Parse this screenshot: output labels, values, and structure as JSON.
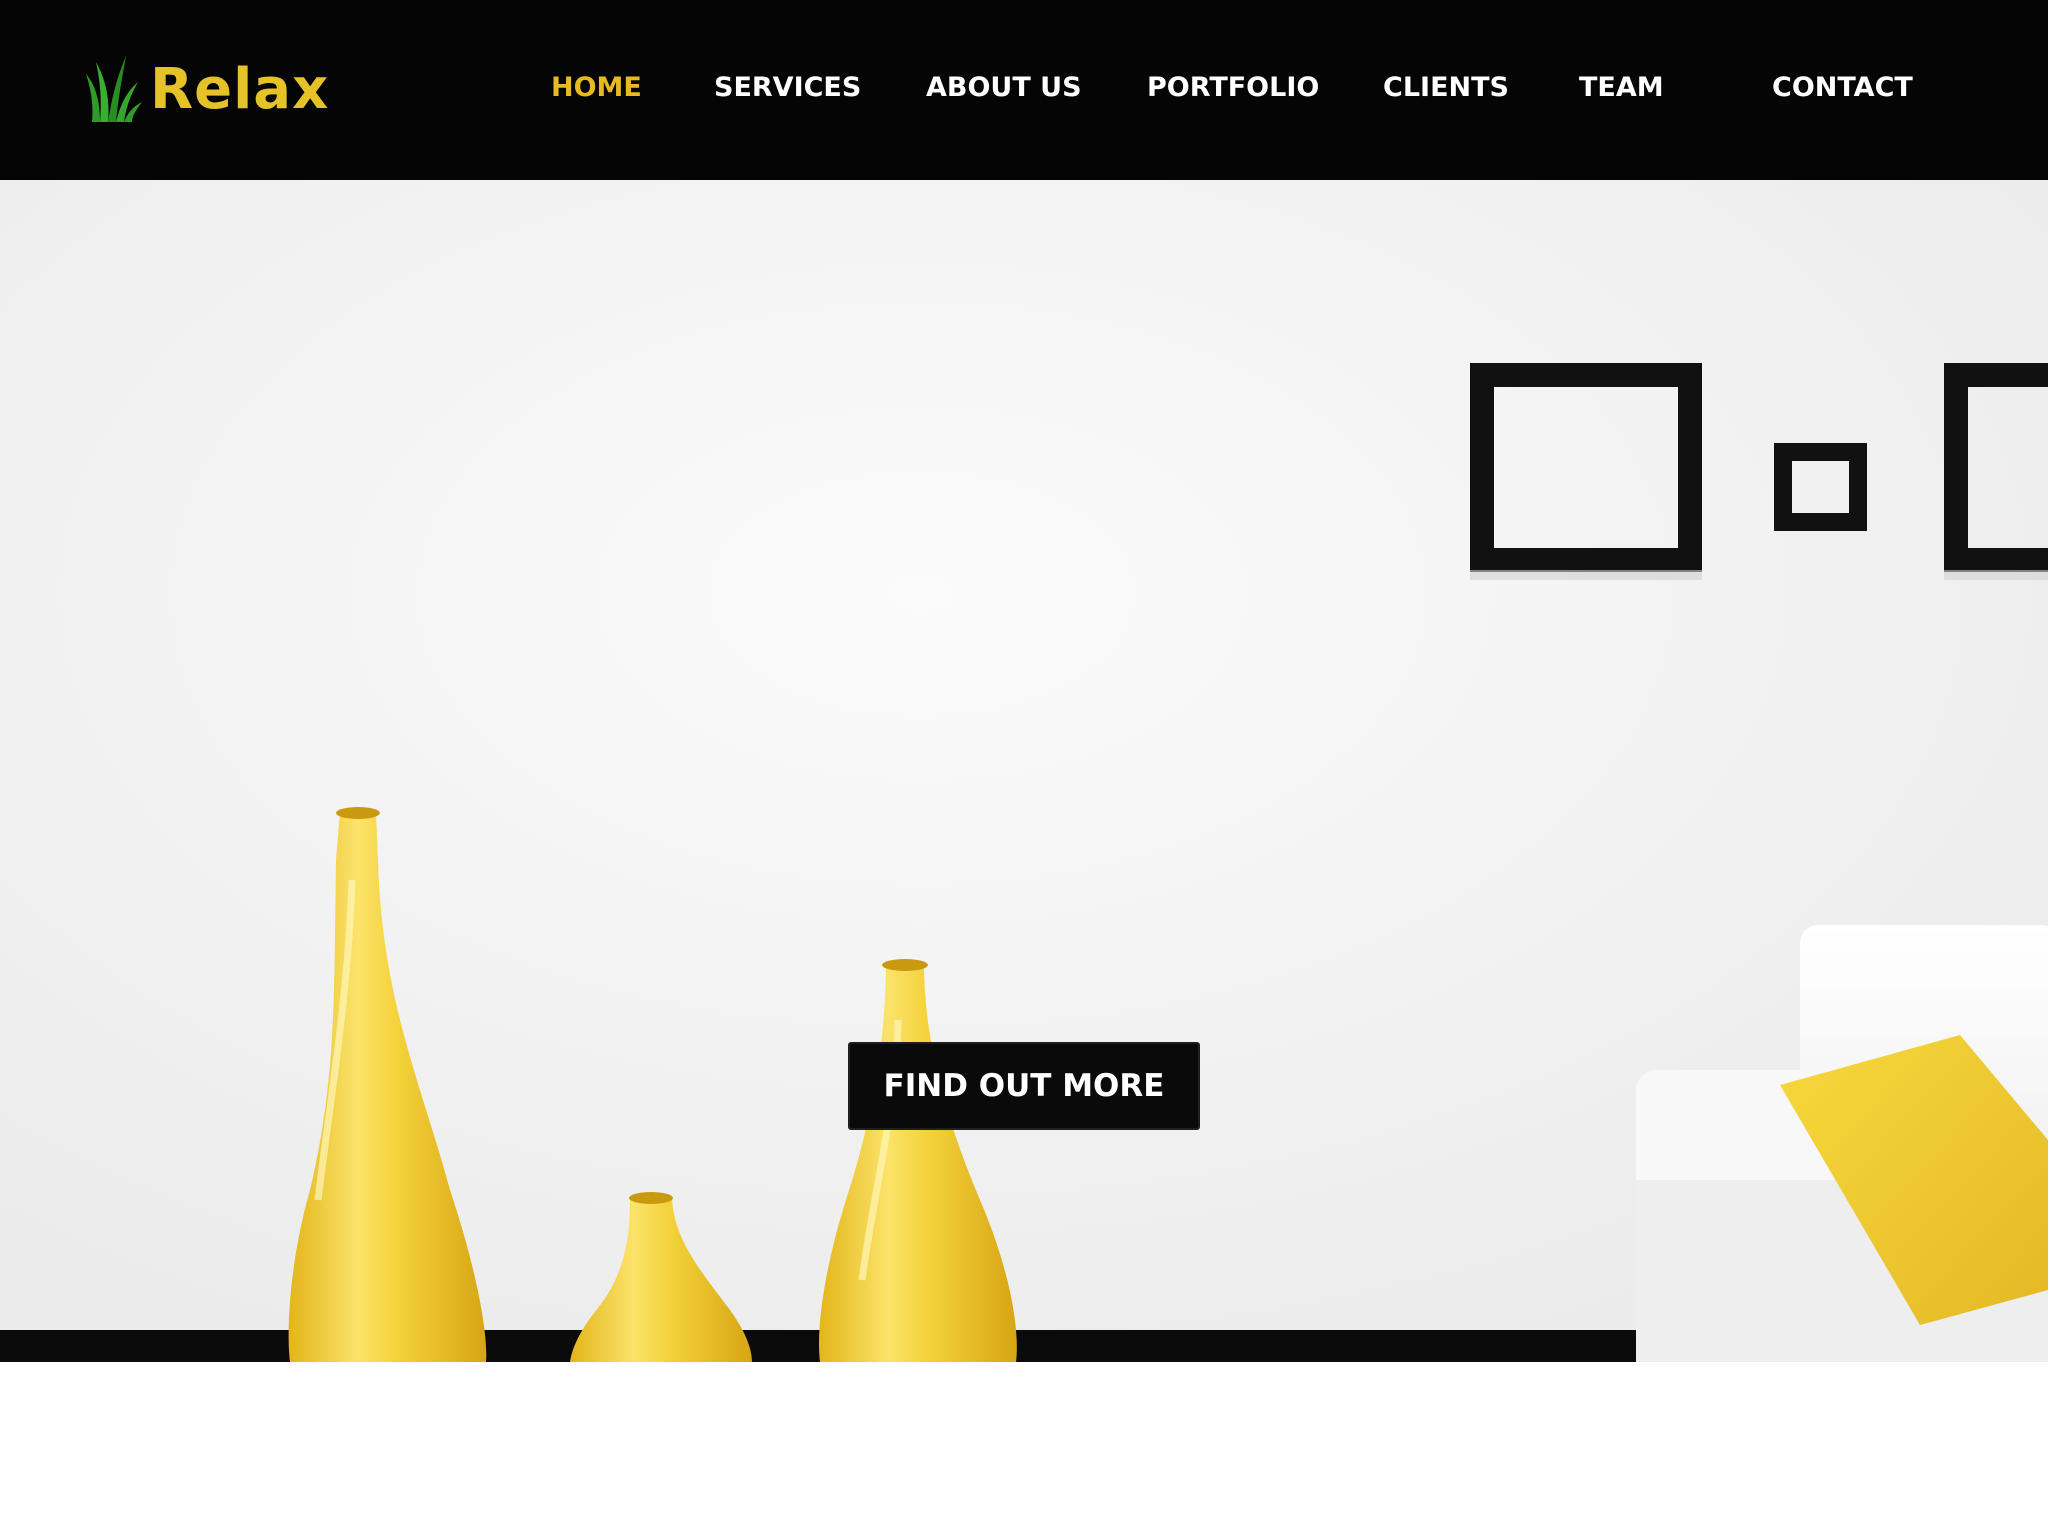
{
  "brand": {
    "name": "Relax",
    "logo_icon": "grass-leaf-icon",
    "logo_color": "#e5c227",
    "icon_color": "#2f9b2a"
  },
  "nav": {
    "items": [
      {
        "label": "HOME",
        "active": true
      },
      {
        "label": "SERVICES",
        "active": false
      },
      {
        "label": "ABOUT US",
        "active": false
      },
      {
        "label": "PORTFOLIO",
        "active": false
      },
      {
        "label": "CLIENTS",
        "active": false
      },
      {
        "label": "TEAM",
        "active": false
      },
      {
        "label": "CONTACT",
        "active": false
      }
    ],
    "active_color": "#e8b923",
    "text_color": "#ffffff",
    "bar_color": "#050505"
  },
  "hero": {
    "cta_label": "FIND OUT MORE",
    "accent_color": "#f2cf2e"
  }
}
